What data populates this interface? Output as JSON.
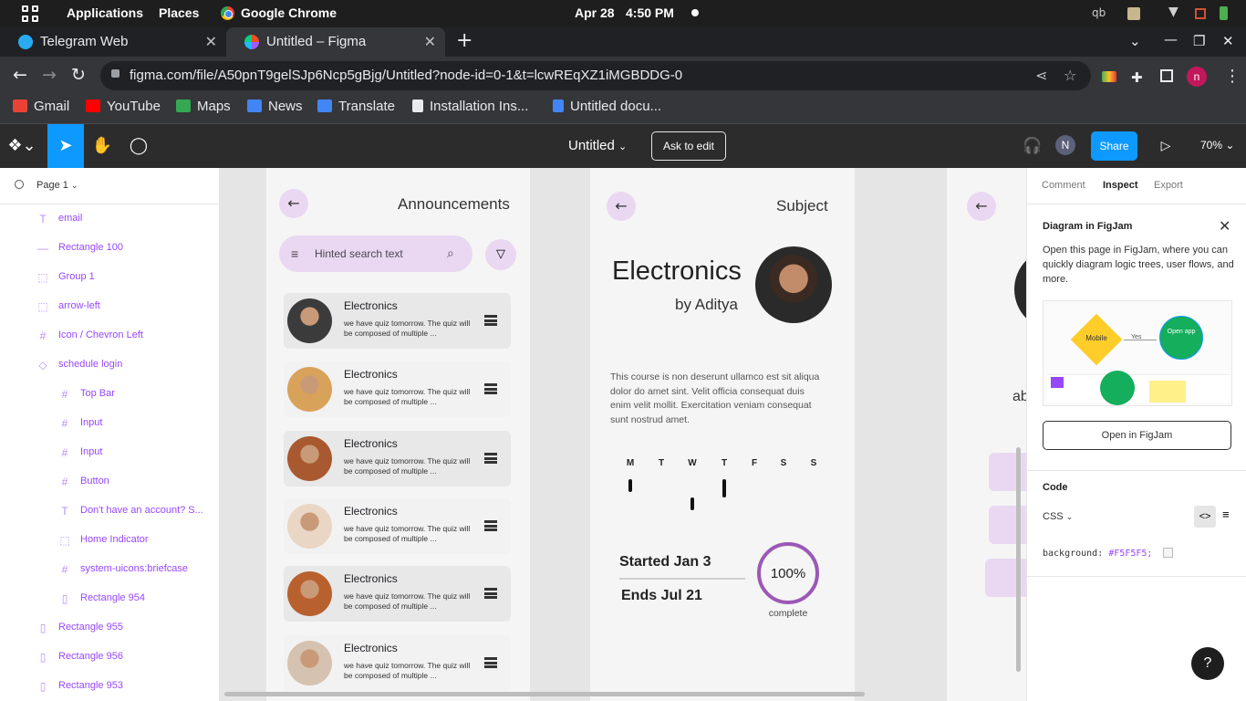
{
  "system_bar": {
    "applications": "Applications",
    "places": "Places",
    "browser": "Google Chrome",
    "date": "Apr 28",
    "time": "4:50 PM",
    "tray_text": "qb"
  },
  "tabs": [
    {
      "label": "Telegram Web",
      "favicon_color": "#2AABEE"
    },
    {
      "label": "Untitled – Figma",
      "favicon_color": "#F24E1E"
    }
  ],
  "address_bar": {
    "url": "figma.com/file/A50pnT9gelSJp6Ncp5gBjg/Untitled?node-id=0-1&t=lcwREqXZ1iMGBDDG-0"
  },
  "profile_initial": "n",
  "bookmarks": [
    {
      "label": "Gmail",
      "color": "#EA4335"
    },
    {
      "label": "YouTube",
      "color": "#FF0000"
    },
    {
      "label": "Maps",
      "color": "#34A853"
    },
    {
      "label": "News",
      "color": "#4285F4"
    },
    {
      "label": "Translate",
      "color": "#4285F4"
    },
    {
      "label": "Installation Ins...",
      "color": "#E8EAED"
    },
    {
      "label": "Untitled docu...",
      "color": "#4285F4"
    }
  ],
  "figma_toolbar": {
    "file_title": "Untitled",
    "ask_to_edit": "Ask to edit",
    "avatar_initial": "N",
    "share": "Share",
    "zoom": "70%",
    "accent": "#0D99FF"
  },
  "layers_panel": {
    "page": "Page 1",
    "layers": [
      {
        "icon": "T",
        "name": "email",
        "indent": 0
      },
      {
        "icon": "—",
        "name": "Rectangle 100",
        "indent": 0
      },
      {
        "icon": "⬚",
        "name": "Group 1",
        "indent": 0
      },
      {
        "icon": "⬚",
        "name": "arrow-left",
        "indent": 0
      },
      {
        "icon": "#",
        "name": "Icon / Chevron Left",
        "indent": 0
      },
      {
        "icon": "◇",
        "name": "schedule login",
        "indent": 0
      },
      {
        "icon": "#",
        "name": "Top Bar",
        "indent": 1
      },
      {
        "icon": "#",
        "name": "Input",
        "indent": 1
      },
      {
        "icon": "#",
        "name": "Input",
        "indent": 1
      },
      {
        "icon": "#",
        "name": "Button",
        "indent": 1
      },
      {
        "icon": "T",
        "name": "Don't have an account? S...",
        "indent": 1
      },
      {
        "icon": "⬚",
        "name": "Home Indicator",
        "indent": 1
      },
      {
        "icon": "#",
        "name": "system-uicons:briefcase",
        "indent": 1
      },
      {
        "icon": "▯",
        "name": "Rectangle 954",
        "indent": 1
      },
      {
        "icon": "▯",
        "name": "Rectangle 955",
        "indent": 0
      },
      {
        "icon": "▯",
        "name": "Rectangle 956",
        "indent": 0
      },
      {
        "icon": "▯",
        "name": "Rectangle 953",
        "indent": 0
      }
    ]
  },
  "announcements_frame": {
    "title": "Announcements",
    "search_placeholder": "Hinted search text",
    "cards": [
      {
        "title": "Electronics",
        "body": "we have quiz tomorrow. The  quiz will be composed of multiple ...",
        "avatar_color": "#3b3b3b"
      },
      {
        "title": "Electronics",
        "body": "we have quiz tomorrow. The  quiz will be composed of multiple ...",
        "avatar_color": "#d9a25a"
      },
      {
        "title": "Electronics",
        "body": "we have quiz tomorrow. The  quiz will be composed of multiple ...",
        "avatar_color": "#a8592f"
      },
      {
        "title": "Electronics",
        "body": "we have quiz tomorrow. The  quiz will be composed of multiple ...",
        "avatar_color": "#e9d6c4"
      },
      {
        "title": "Electronics",
        "body": "we have quiz tomorrow. The  quiz will be composed of multiple ...",
        "avatar_color": "#b9612e"
      },
      {
        "title": "Electronics",
        "body": "we have quiz tomorrow. The  quiz will be composed of multiple ...",
        "avatar_color": "#d6c2b0"
      }
    ]
  },
  "subject_frame": {
    "header": "Subject",
    "course": "Electronics",
    "instructor": "by Aditya",
    "description": "This course is non deserunt ullamco est sit aliqua dolor do amet sint. Velit officia consequat duis enim velit mollit. Exercitation veniam consequat sunt nostrud amet.",
    "weekdays": [
      "M",
      "T",
      "W",
      "T",
      "F",
      "S",
      "S"
    ],
    "started": "Started Jan 3",
    "ends": "Ends Jul 21",
    "progress_label": "100%",
    "progress_value": 1.0,
    "progress_caption": "complete",
    "progress_color": "#9B59B6"
  },
  "third_frame": {
    "partial_text": "ab"
  },
  "inspect_panel": {
    "tabs": [
      "Comment",
      "Inspect",
      "Export"
    ],
    "figjam_title": "Diagram in FigJam",
    "figjam_body": "Open this page in FigJam, where you can quickly diagram logic trees, user flows, and more.",
    "diagram_mobile": "Mobile",
    "diagram_yes": "Yes",
    "diagram_open_app": "Open app",
    "open_in_figjam": "Open in FigJam",
    "code_title": "Code",
    "language": "CSS",
    "code_property": "background:",
    "code_value": "#F5F5F5;"
  },
  "help": "?"
}
